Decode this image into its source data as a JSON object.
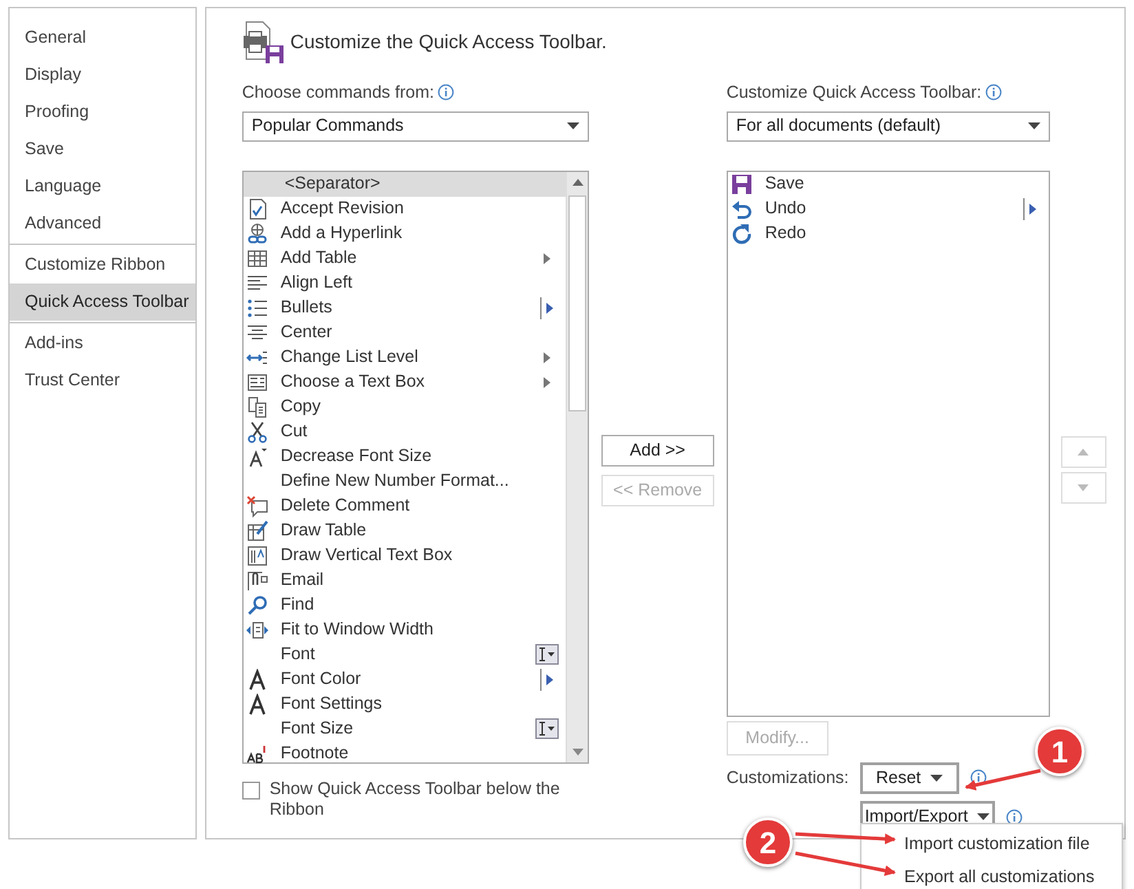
{
  "sidebar": {
    "items": [
      {
        "label": "General",
        "selected": false
      },
      {
        "label": "Display",
        "selected": false
      },
      {
        "label": "Proofing",
        "selected": false
      },
      {
        "label": "Save",
        "selected": false
      },
      {
        "label": "Language",
        "selected": false
      },
      {
        "label": "Advanced",
        "selected": false
      },
      {
        "label": "Customize Ribbon",
        "selected": false,
        "divider_before": true
      },
      {
        "label": "Quick Access Toolbar",
        "selected": true
      },
      {
        "label": "Add-ins",
        "selected": false,
        "divider_before": true
      },
      {
        "label": "Trust Center",
        "selected": false
      }
    ]
  },
  "title": "Customize the Quick Access Toolbar.",
  "commands_from": {
    "label": "Choose commands from:",
    "value": "Popular Commands"
  },
  "commands": [
    {
      "label": "<Separator>",
      "selected": true,
      "kind": "plain"
    },
    {
      "label": "Accept Revision",
      "selected": false,
      "kind": "plain"
    },
    {
      "label": "Add a Hyperlink",
      "selected": false,
      "kind": "plain"
    },
    {
      "label": "Add Table",
      "selected": false,
      "kind": "submenu"
    },
    {
      "label": "Align Left",
      "selected": false,
      "kind": "plain"
    },
    {
      "label": "Bullets",
      "selected": false,
      "kind": "split"
    },
    {
      "label": "Center",
      "selected": false,
      "kind": "plain"
    },
    {
      "label": "Change List Level",
      "selected": false,
      "kind": "submenu"
    },
    {
      "label": "Choose a Text Box",
      "selected": false,
      "kind": "submenu"
    },
    {
      "label": "Copy",
      "selected": false,
      "kind": "plain"
    },
    {
      "label": "Cut",
      "selected": false,
      "kind": "plain"
    },
    {
      "label": "Decrease Font Size",
      "selected": false,
      "kind": "plain"
    },
    {
      "label": "Define New Number Format...",
      "selected": false,
      "kind": "plain"
    },
    {
      "label": "Delete Comment",
      "selected": false,
      "kind": "plain"
    },
    {
      "label": "Draw Table",
      "selected": false,
      "kind": "plain"
    },
    {
      "label": "Draw Vertical Text Box",
      "selected": false,
      "kind": "plain"
    },
    {
      "label": "Email",
      "selected": false,
      "kind": "plain"
    },
    {
      "label": "Find",
      "selected": false,
      "kind": "plain"
    },
    {
      "label": "Fit to Window Width",
      "selected": false,
      "kind": "plain"
    },
    {
      "label": "Font",
      "selected": false,
      "kind": "combo"
    },
    {
      "label": "Font Color",
      "selected": false,
      "kind": "split"
    },
    {
      "label": "Font Settings",
      "selected": false,
      "kind": "plain"
    },
    {
      "label": "Font Size",
      "selected": false,
      "kind": "combo"
    },
    {
      "label": "Footnote",
      "selected": false,
      "kind": "plain"
    }
  ],
  "show_below": {
    "label": "Show Quick Access Toolbar below the Ribbon",
    "checked": false
  },
  "add_button": {
    "label": "Add >>",
    "disabled": false
  },
  "remove_button": {
    "label": "<< Remove",
    "disabled": true
  },
  "toolbar_for": {
    "label": "Customize Quick Access Toolbar:",
    "value": "For all documents (default)"
  },
  "toolbar_items": [
    {
      "label": "Save",
      "selected": false,
      "kind": "plain"
    },
    {
      "label": "Undo",
      "selected": false,
      "kind": "split"
    },
    {
      "label": "Redo",
      "selected": false,
      "kind": "plain"
    }
  ],
  "modify_button": {
    "label": "Modify...",
    "disabled": true
  },
  "customizations_label": "Customizations:",
  "reset_button": {
    "label": "Reset"
  },
  "import_export_button": {
    "label": "Import/Export",
    "expanded": true
  },
  "import_export_menu": [
    {
      "label": "Import customization file"
    },
    {
      "label": "Export all customizations"
    }
  ],
  "move_up": {
    "disabled": true
  },
  "move_down": {
    "disabled": true
  },
  "annotations": [
    {
      "label": "1"
    },
    {
      "label": "2"
    }
  ]
}
